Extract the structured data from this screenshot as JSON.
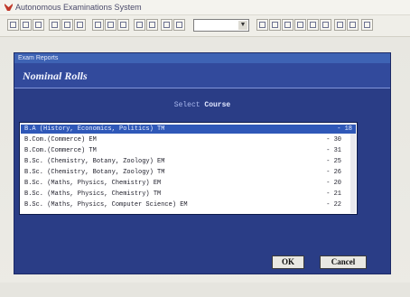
{
  "window": {
    "title": "Autonomous Examinations System"
  },
  "toolbar": {
    "buttons": [
      "b1",
      "b2",
      "b3",
      "b4",
      "b5",
      "b6",
      "b7",
      "b8",
      "b9",
      "b10",
      "b11",
      "b12",
      "b13",
      "b14",
      "b15",
      "b16",
      "b17",
      "b18",
      "b19",
      "b20",
      "b21",
      "b22",
      "b23"
    ],
    "select_value": "",
    "dropdown_glyph": "▼"
  },
  "dialog": {
    "caption": "Exam Reports",
    "heading": "Nominal Rolls",
    "select_prefix": "Select ",
    "select_emph": "Course",
    "courses": [
      {
        "name": "B.A  (History, Economics, Politics) TM",
        "count": "- 18"
      },
      {
        "name": "B.Com.(Commerce) EM",
        "count": "- 30"
      },
      {
        "name": "B.Com.(Commerce) TM",
        "count": "- 31"
      },
      {
        "name": "B.Sc. (Chemistry, Botany, Zoology) EM",
        "count": "- 25"
      },
      {
        "name": "B.Sc. (Chemistry, Botany, Zoology) TM",
        "count": "- 26"
      },
      {
        "name": "B.Sc. (Maths, Physics, Chemistry) EM",
        "count": "- 20"
      },
      {
        "name": "B.Sc. (Maths, Physics, Chemistry) TM",
        "count": "- 21"
      },
      {
        "name": "B.Sc. (Maths, Physics, Computer Science) EM",
        "count": "- 22"
      }
    ],
    "selected_index": 0,
    "ok_label": "OK",
    "cancel_label": "Cancel"
  },
  "colors": {
    "dialog_bg": "#2a3d86",
    "selection": "#2f58b8",
    "logo": "#c0392b"
  }
}
